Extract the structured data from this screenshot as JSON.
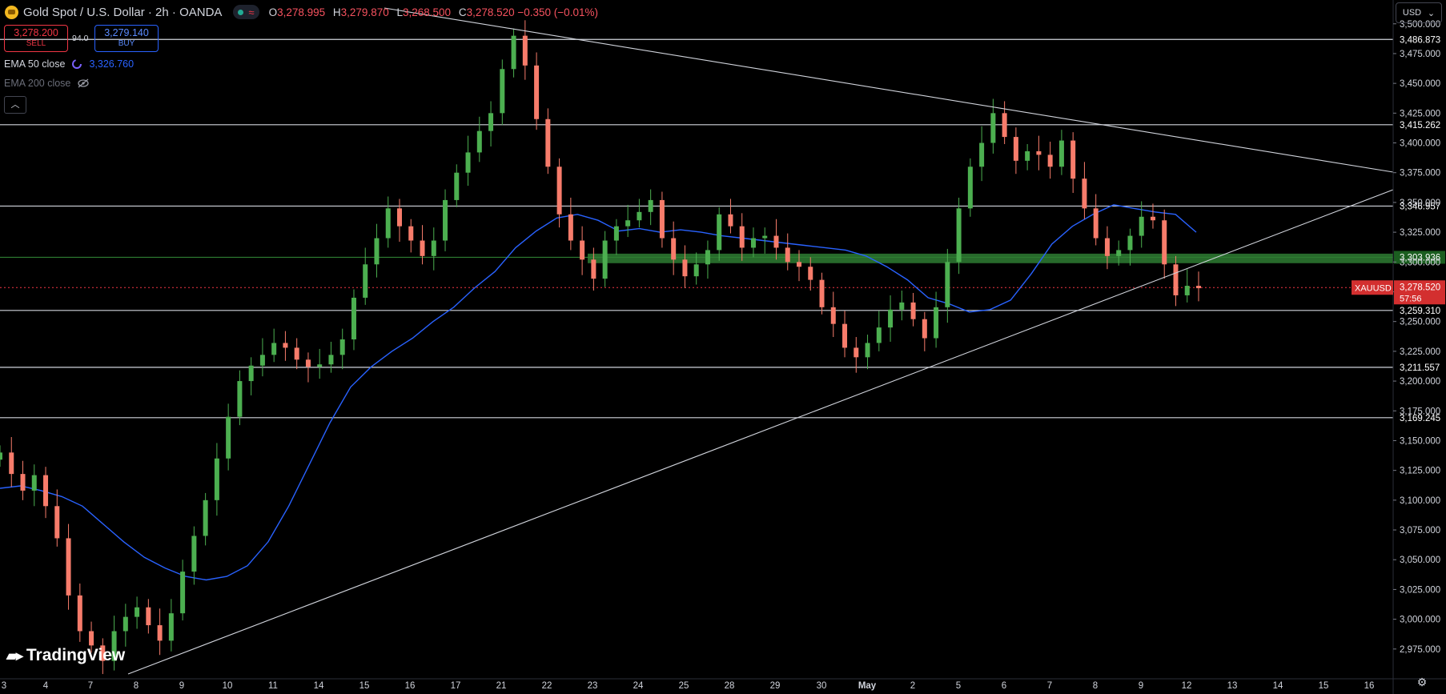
{
  "header": {
    "title": "Gold Spot / U.S. Dollar · 2h · OANDA",
    "ohlc": [
      {
        "k": "O",
        "v": "3,278.995"
      },
      {
        "k": "H",
        "v": "3,279.870"
      },
      {
        "k": "L",
        "v": "3,268.500"
      },
      {
        "k": "C",
        "v": "3,278.520 −0.350 (−0.01%)"
      }
    ],
    "icons": [
      "gold-coin-icon",
      "market-open-dot-icon",
      "wave-icon"
    ]
  },
  "trade": {
    "sell_price": "3,278.200",
    "sell_label": "SELL",
    "buy_price": "3,279.140",
    "buy_label": "BUY",
    "spread": "94.0"
  },
  "indicators": {
    "ema50_label": "EMA 50 close",
    "ema50_value": "3,326.760",
    "ema200_label": "EMA 200 close"
  },
  "currency": "USD",
  "watermark": "TradingView",
  "price_tag": {
    "symbol": "XAUUSD",
    "price": "3,278.520",
    "countdown": "57:56"
  },
  "colors": {
    "up": "#26a69a",
    "down": "#ef5350",
    "up_candle": "#4caf50",
    "down_candle": "#f77c6b",
    "ema50": "#2962ff",
    "support_zone": "#2e7d32",
    "bg": "#000000"
  },
  "chart_data": {
    "type": "candlestick",
    "symbol": "XAUUSD",
    "timeframe": "2h",
    "ylim": [
      2950,
      3520
    ],
    "y_ticks": [
      "2,975.000",
      "3,000.000",
      "3,025.000",
      "3,050.000",
      "3,075.000",
      "3,100.000",
      "3,125.000",
      "3,150.000",
      "3,175.000",
      "3,200.000",
      "3,225.000",
      "3,250.000",
      "3,275.000",
      "3,300.000",
      "3,325.000",
      "3,350.000",
      "3,375.000",
      "3,400.000",
      "3,425.000",
      "3,450.000",
      "3,475.000",
      "3,500.000"
    ],
    "x_ticks": [
      "3",
      "4",
      "7",
      "8",
      "9",
      "10",
      "11",
      "14",
      "15",
      "16",
      "17",
      "21",
      "22",
      "23",
      "24",
      "25",
      "28",
      "29",
      "30",
      "May",
      "2",
      "5",
      "6",
      "7",
      "8",
      "9",
      "12",
      "13",
      "14",
      "15",
      "16"
    ],
    "horizontal_levels": [
      {
        "price": 3486.873,
        "label": "3,486.873"
      },
      {
        "price": 3415.262,
        "label": "3,415.262"
      },
      {
        "price": 3346.957,
        "label": "3,346.957"
      },
      {
        "price": 3303.936,
        "label": "3,303.936",
        "color": "#2e7d32"
      },
      {
        "price": 3259.31,
        "label": "3,259.310"
      },
      {
        "price": 3211.557,
        "label": "3,211.557"
      },
      {
        "price": 3169.245,
        "label": "3,169.245"
      }
    ],
    "current_price": 3278.52,
    "trendlines": [
      {
        "from": {
          "x": "17",
          "y": 3520
        },
        "to": {
          "x": "16",
          "y": 3382
        }
      },
      {
        "from": {
          "x": "8",
          "y": 2965
        },
        "to": {
          "x": "16",
          "y": 3368
        }
      }
    ],
    "closes": [
      3140,
      3122,
      3108,
      3121,
      3095,
      3068,
      3020,
      2990,
      2978,
      2965,
      2990,
      3002,
      3010,
      2995,
      2982,
      3005,
      3040,
      3070,
      3100,
      3135,
      3170,
      3200,
      3213,
      3222,
      3232,
      3228,
      3218,
      3212,
      3214,
      3222,
      3235,
      3270,
      3298,
      3320,
      3345,
      3330,
      3318,
      3305,
      3318,
      3352,
      3375,
      3392,
      3410,
      3425,
      3462,
      3490,
      3465,
      3420,
      3380,
      3340,
      3318,
      3302,
      3286,
      3318,
      3330,
      3335,
      3342,
      3352,
      3320,
      3302,
      3288,
      3298,
      3310,
      3340,
      3330,
      3312,
      3320,
      3322,
      3312,
      3300,
      3296,
      3285,
      3262,
      3248,
      3228,
      3220,
      3232,
      3245,
      3260,
      3266,
      3252,
      3236,
      3262,
      3300,
      3345,
      3380,
      3400,
      3425,
      3405,
      3385,
      3393,
      3390,
      3380,
      3402,
      3370,
      3345,
      3320,
      3305,
      3310,
      3322,
      3338,
      3335,
      3298,
      3272,
      3280,
      3278
    ],
    "ema50": [
      3110,
      3112,
      3108,
      3103,
      3095,
      3080,
      3065,
      3052,
      3043,
      3036,
      3033,
      3036,
      3045,
      3065,
      3095,
      3130,
      3165,
      3195,
      3212,
      3225,
      3236,
      3250,
      3262,
      3278,
      3292,
      3312,
      3326,
      3337,
      3340,
      3335,
      3326,
      3328,
      3325,
      3327,
      3325,
      3322,
      3320,
      3318,
      3316,
      3314,
      3312,
      3310,
      3305,
      3296,
      3285,
      3270,
      3265,
      3258,
      3260,
      3268,
      3290,
      3315,
      3330,
      3340,
      3348,
      3345,
      3342,
      3340,
      3325
    ]
  }
}
